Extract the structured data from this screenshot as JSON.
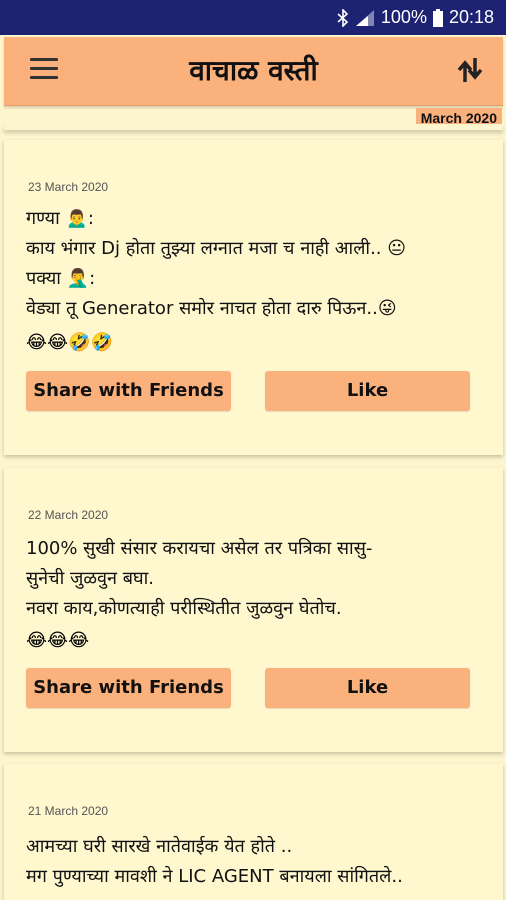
{
  "status_bar": {
    "battery": "100%",
    "time": "20:18",
    "icons": [
      "bluetooth-icon",
      "signal-icon",
      "battery-icon"
    ]
  },
  "app": {
    "title": "वाचाळ वस्ती",
    "month_badge": "March 2020",
    "colors": {
      "accent": "#fbb17c",
      "background": "#fdf5cd",
      "statusbar": "#1d2272"
    }
  },
  "posts": [
    {
      "date": "23 March 2020",
      "text": "गण्या 🙍‍♂️:\nकाय भंगार Dj होता तुझ्या लग्नात मजा च नाही आली.. 😐\nपक्या 🤦‍♂️:\nवेड्या तू Generator समोर नाचत होता दारु पिऊन..😜",
      "emojis": "😂😂🤣🤣",
      "share_label": "Share with Friends",
      "like_label": "Like"
    },
    {
      "date": "22 March 2020",
      "text": "100% सुखी संसार करायचा असेल तर पत्रिका सासु-\nसुनेची जुळवुन बघा.\nनवरा काय,कोणत्याही परीस्थितीत जुळवुन घेतोच.",
      "emojis": "😂😂😂",
      "share_label": "Share with Friends",
      "like_label": "Like"
    },
    {
      "date": "21 March 2020",
      "text": "आमच्या घरी सारखे नातेवाईक येत होते ..\nमग पुण्याच्या मावशी ने LIC AGENT बनायला सांगितले.."
    }
  ]
}
